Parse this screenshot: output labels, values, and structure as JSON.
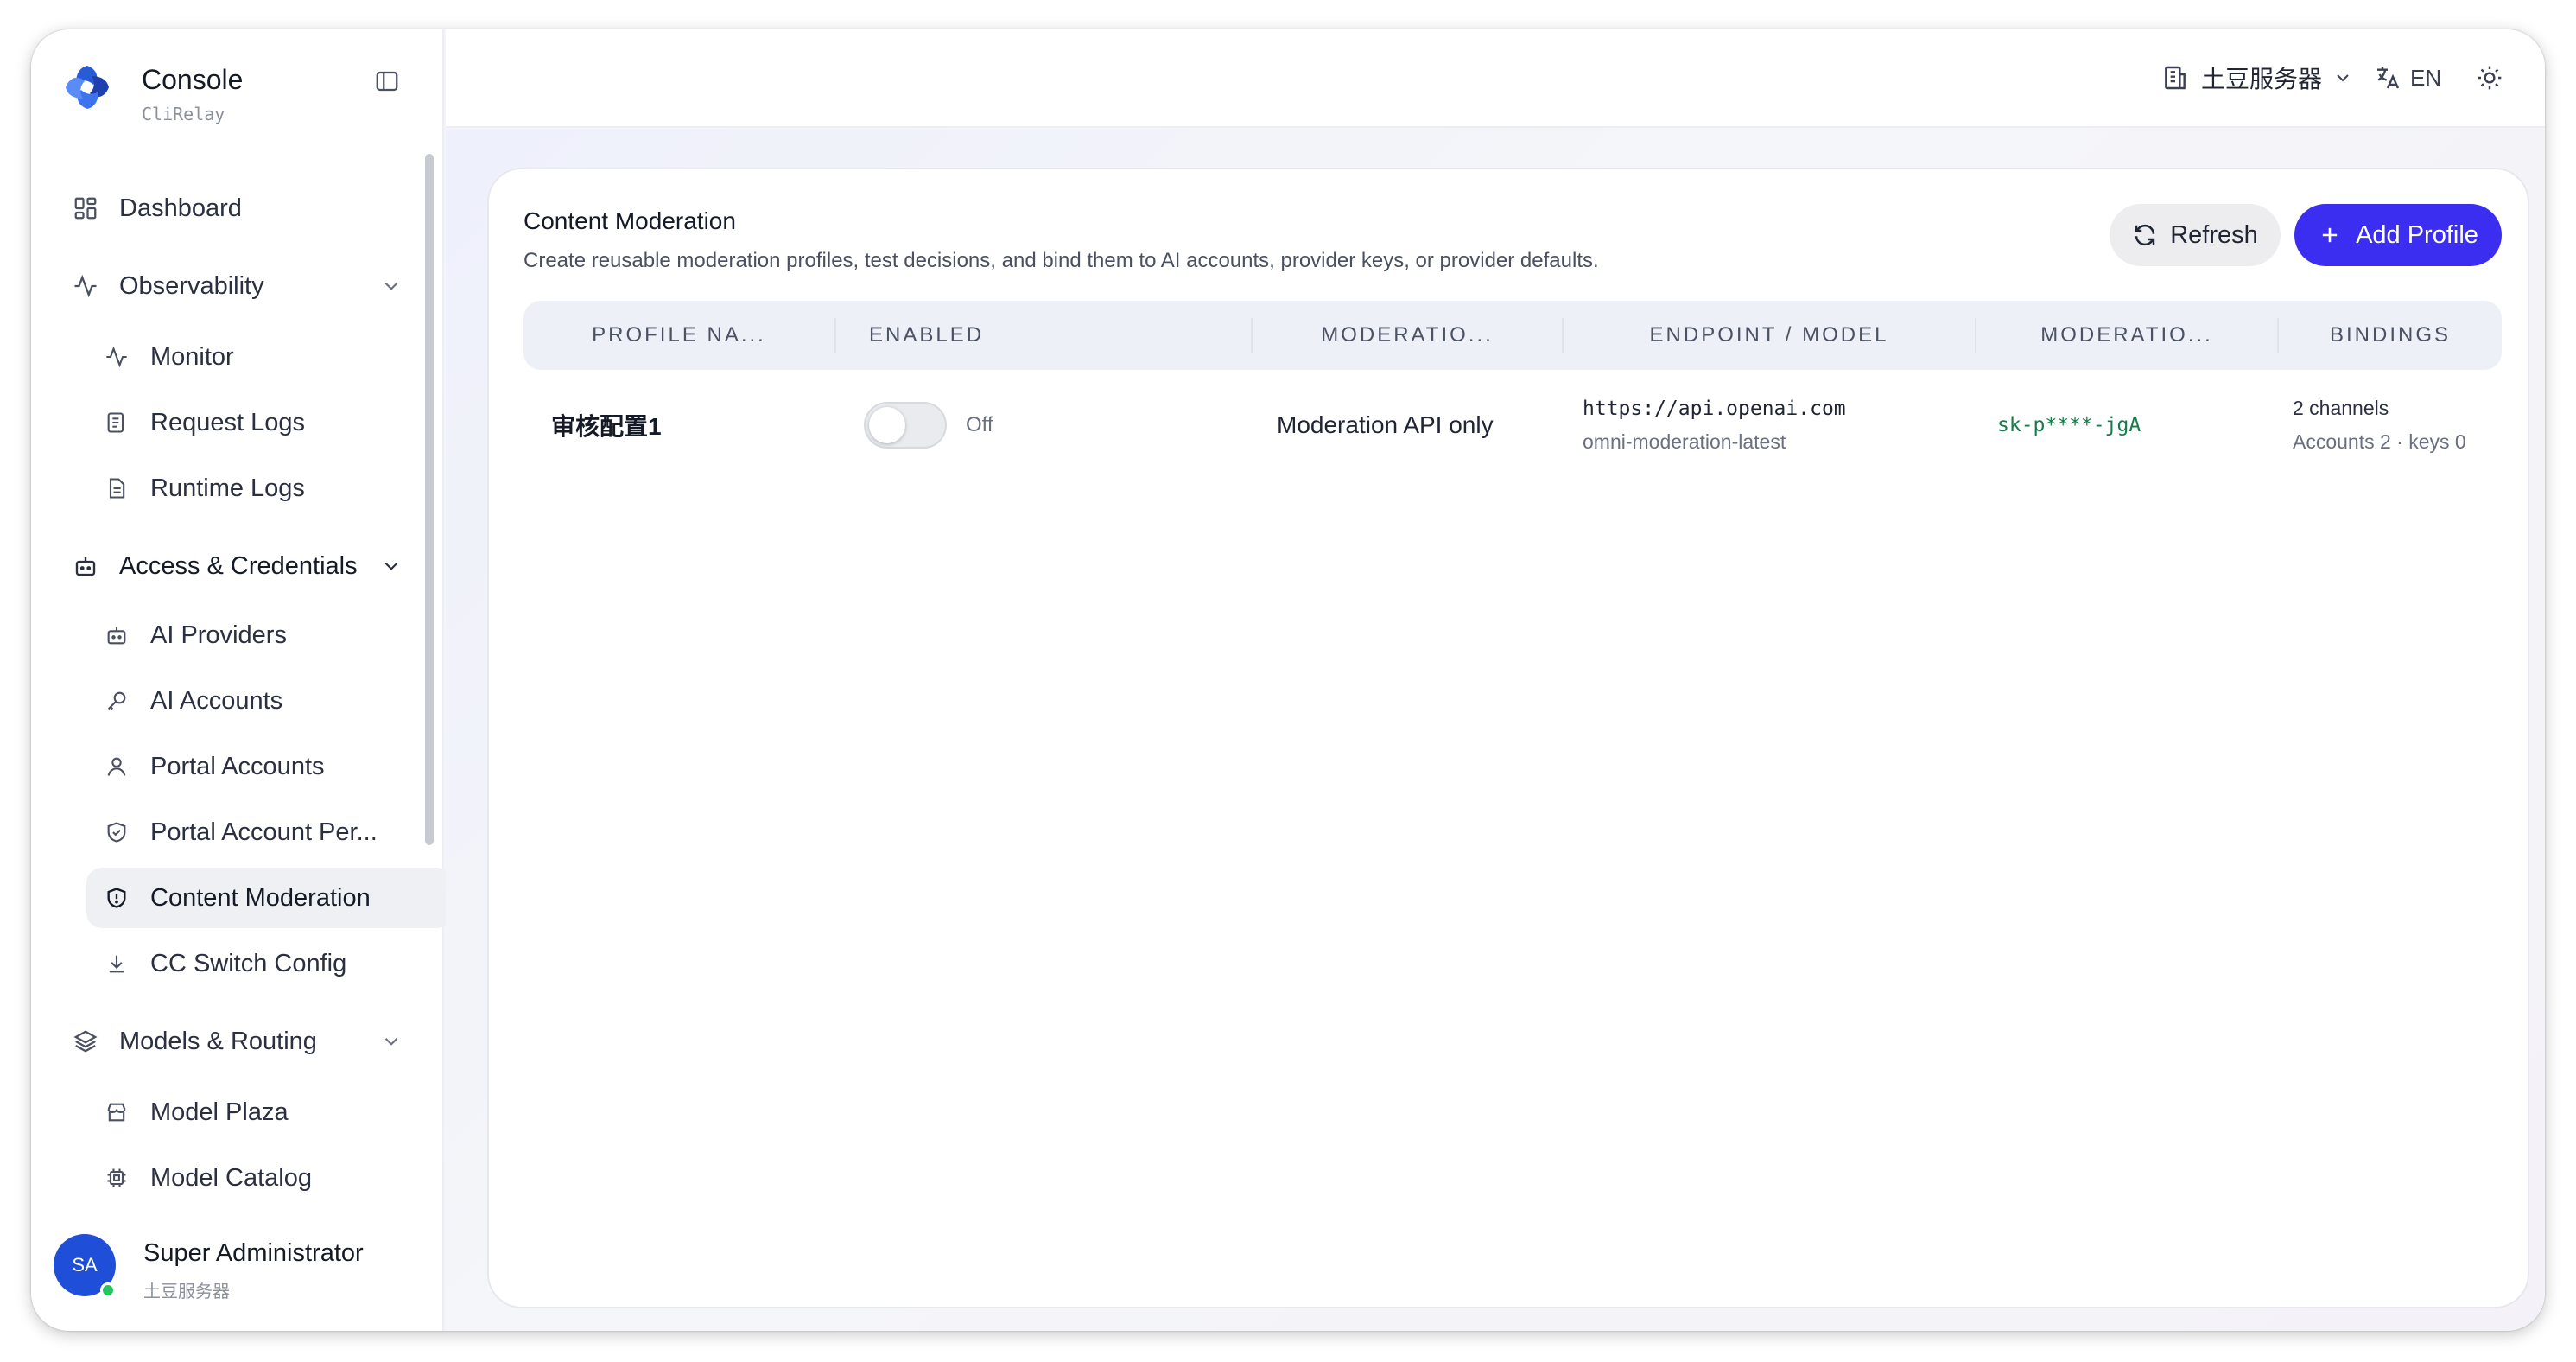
{
  "brand": {
    "title": "Console",
    "subtitle": "CliRelay"
  },
  "sidebar": {
    "items": [
      {
        "label": "Dashboard",
        "icon": "dashboard-icon"
      },
      {
        "label": "Observability",
        "icon": "activity-icon"
      },
      {
        "label": "Monitor",
        "icon": "activity-icon"
      },
      {
        "label": "Request Logs",
        "icon": "request-logs-icon"
      },
      {
        "label": "Runtime Logs",
        "icon": "document-icon"
      },
      {
        "label": "Access & Credentials",
        "icon": "bot-icon"
      },
      {
        "label": "AI Providers",
        "icon": "bot-icon"
      },
      {
        "label": "AI Accounts",
        "icon": "key-icon"
      },
      {
        "label": "Portal Accounts",
        "icon": "user-icon"
      },
      {
        "label": "Portal Account Per...",
        "icon": "shield-check-icon"
      },
      {
        "label": "Content Moderation",
        "icon": "shield-alert-icon",
        "active": true
      },
      {
        "label": "CC Switch Config",
        "icon": "download-icon"
      },
      {
        "label": "Models & Routing",
        "icon": "layers-icon"
      },
      {
        "label": "Model Plaza",
        "icon": "store-icon"
      },
      {
        "label": "Model Catalog",
        "icon": "chip-icon"
      }
    ]
  },
  "user": {
    "initials": "SA",
    "name": "Super Administrator",
    "org": "土豆服务器"
  },
  "header": {
    "server": "土豆服务器",
    "language": "EN"
  },
  "page": {
    "title": "Content Moderation",
    "description": "Create reusable moderation profiles, test decisions, and bind them to AI accounts, provider keys, or provider defaults.",
    "refresh_label": "Refresh",
    "add_label": "Add Profile"
  },
  "table": {
    "columns": [
      "PROFILE NA...",
      "ENABLED",
      "MODERATIO...",
      "ENDPOINT / MODEL",
      "MODERATIO...",
      "BINDINGS"
    ],
    "rows": [
      {
        "name": "审核配置1",
        "enabled_label": "Off",
        "mode": "Moderation API only",
        "endpoint": "https://api.openai.com",
        "model": "omni-moderation-latest",
        "key": "sk-p****-jgA",
        "bindings": "2 channels",
        "bindings_detail": "Accounts 2 · keys 0"
      }
    ]
  },
  "colors": {
    "accent": "#3b2ef0",
    "key_text": "#167a4a",
    "avatar": "#1f4fd8",
    "online": "#22c55e"
  }
}
